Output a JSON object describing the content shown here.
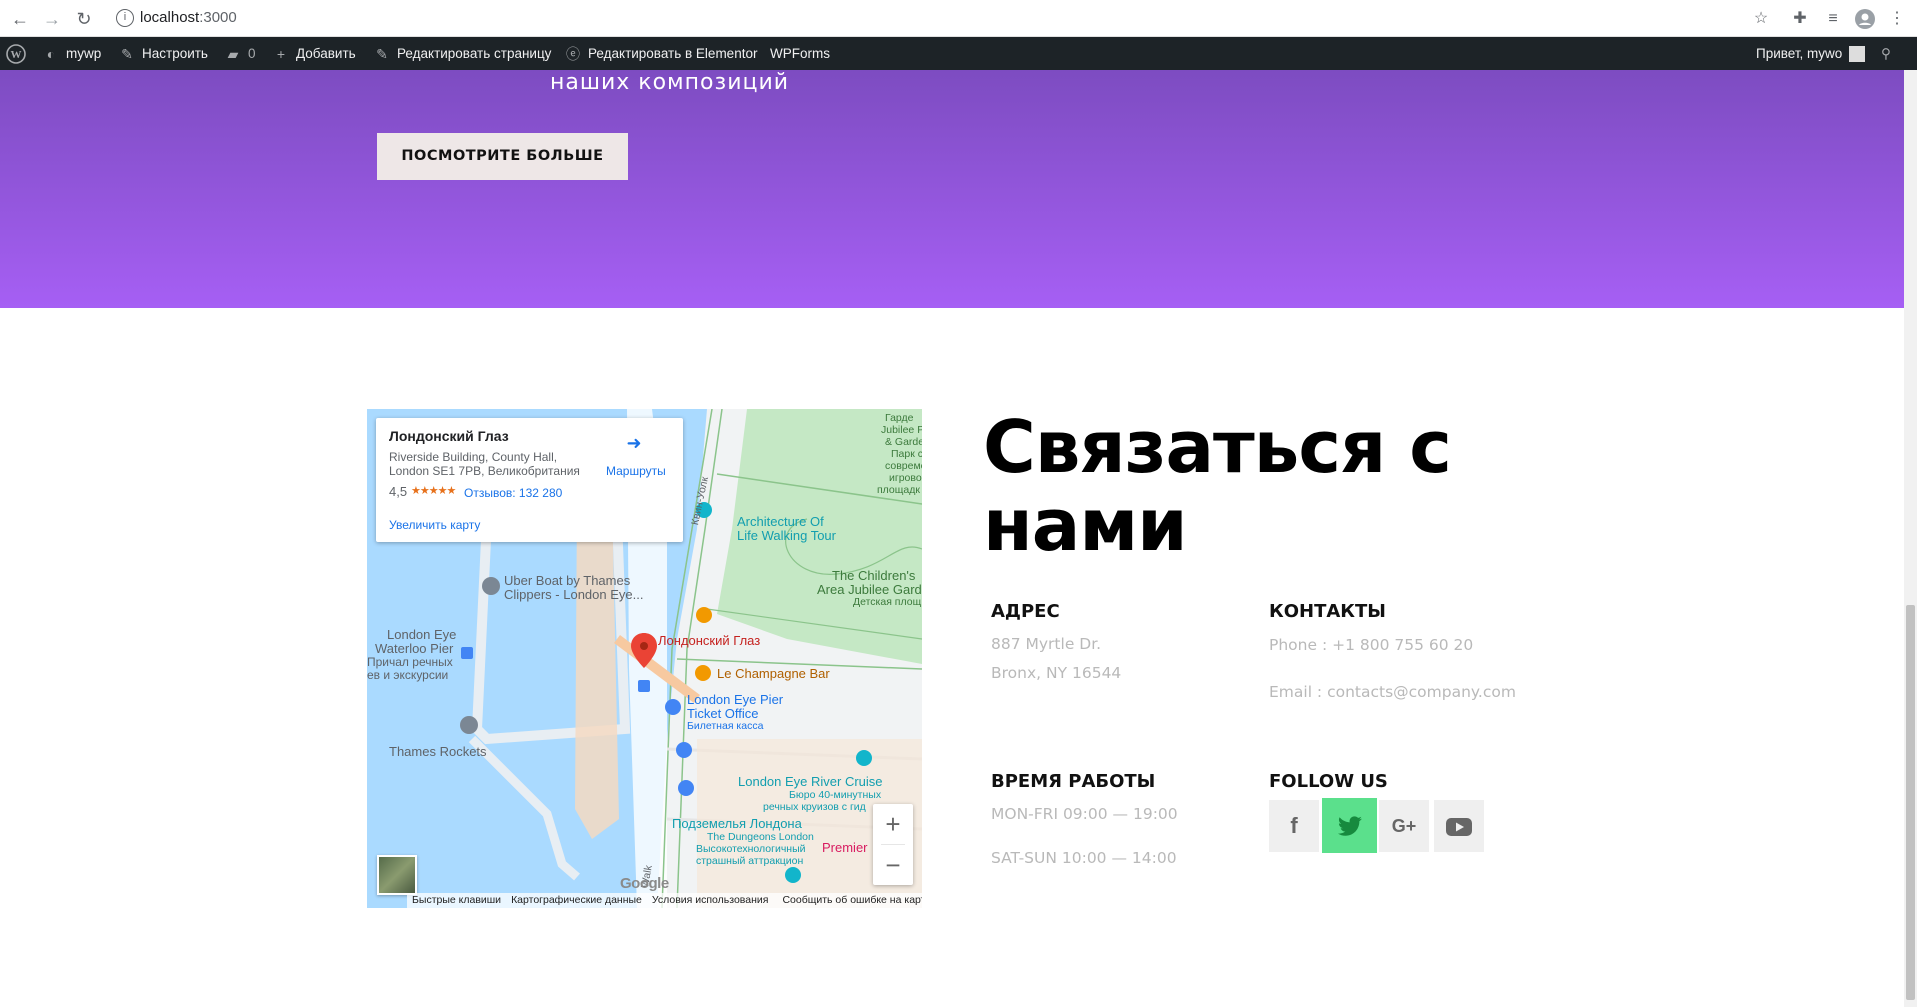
{
  "browser": {
    "url_host": "localhost",
    "url_port": ":3000"
  },
  "admin_bar": {
    "site_name": "mywp",
    "customize": "Настроить",
    "comments_count": "0",
    "add_new": "Добавить",
    "edit_page": "Редактировать страницу",
    "edit_elementor": "Редактировать в Elementor",
    "wpforms": "WPForms",
    "greeting": "Привет, mywo"
  },
  "hero": {
    "subtitle": "наших композиций",
    "button_label": "ПОСМОТРИТЕ БОЛЬШЕ"
  },
  "map": {
    "card": {
      "title": "Лондонский Глаз",
      "address": "Riverside Building, County Hall, London SE1 7PB, Великобритания",
      "rating": "4,5",
      "stars": "★★★★★",
      "reviews": "Отзывов: 132 280",
      "enlarge": "Увеличить карту",
      "directions": "Маршруты"
    },
    "labels": {
      "marker": "Лондонский Глаз",
      "uber_boat": "Uber Boat by Thames Clippers - London Eye...",
      "london_eye_pier_1": "London Eye",
      "london_eye_pier_2": "Waterloo Pier",
      "pier_ru_1": "Причал речных",
      "pier_ru_2": "ев и экскурсии",
      "thames_rockets": "Thames Rockets",
      "architecture_1": "Architecture Of",
      "architecture_2": "Life Walking Tour",
      "childrens_1": "The Children's",
      "childrens_2": "Area Jubilee Gard",
      "childrens_ru": "Детская площ",
      "champagne": "Le Champagne Bar",
      "ticket_1": "London Eye Pier",
      "ticket_2": "Ticket Office",
      "ticket_ru": "Билетная касса",
      "river_cruise": "London Eye River Cruise",
      "cruise_ru_1": "Бюро 40-минутных",
      "cruise_ru_2": "речных круизов с гид",
      "dungeons_ru": "Подземелья Лондона",
      "dungeons_1": "The Dungeons London",
      "dungeons_2": "Высокотехнологичный",
      "dungeons_3": "страшный аттракцион",
      "premier": "Premier",
      "street": "Квин-Уолк",
      "walk": "Walk",
      "jubilee_1": "Гарде",
      "jubilee_2": "Jubilee P",
      "jubilee_3": "& Garde",
      "park_1": "Парк с",
      "park_2": "совреме",
      "park_3": "игрово",
      "park_4": "площадк"
    },
    "footer": {
      "shortcuts": "Быстрые клавиши",
      "map_data": "Картографические данные",
      "terms": "Условия использования",
      "report": "Сообщить об ошибке на карте"
    },
    "google": "Google"
  },
  "contact": {
    "title": "Связаться с нами",
    "address_head": "АДРЕС",
    "address_line1": "887 Myrtle Dr.",
    "address_line2": "Bronx, NY 16544",
    "contacts_head": "КОНТАКТЫ",
    "phone": "Phone : +1 800 755 60 20",
    "email": "Email : contacts@company.com",
    "hours_head": "ВРЕМЯ РАБОТЫ",
    "hours_weekday": "MON-FRI 09:00 — 19:00",
    "hours_weekend": "SAT-SUN 10:00 — 14:00",
    "follow_head": "FOLLOW US",
    "social": [
      "facebook-icon",
      "twitter-icon",
      "google-plus-icon",
      "youtube-icon"
    ]
  },
  "colors": {
    "hero_top": "#7d4cc1",
    "hero_bottom": "#a65ff4",
    "twitter_active": "#5be08c"
  }
}
